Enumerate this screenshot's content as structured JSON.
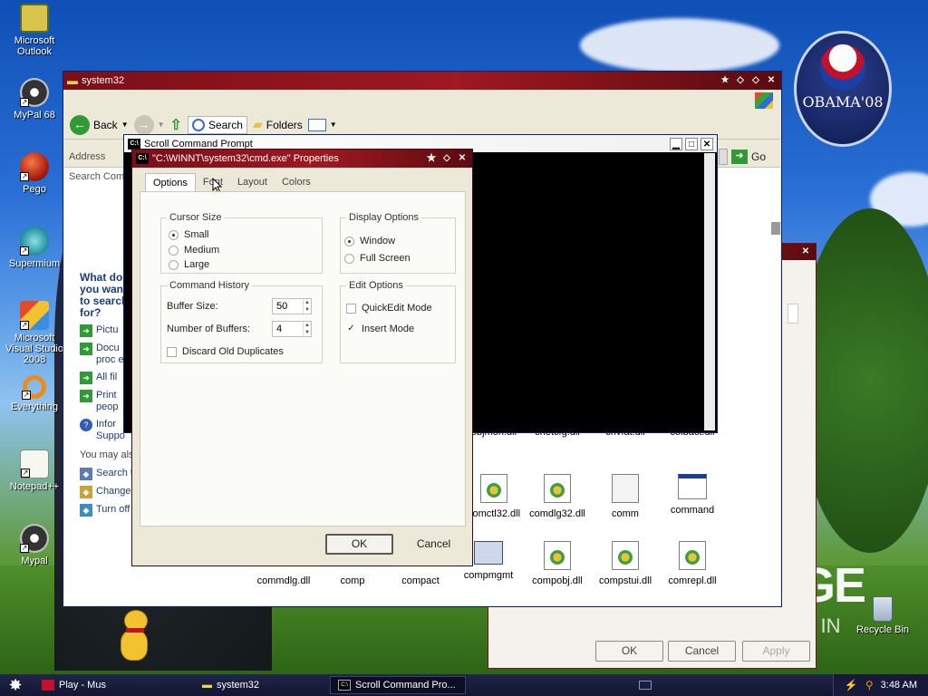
{
  "desktop": {
    "icons": [
      {
        "id": "outlook",
        "label": "Microsoft Outlook",
        "icon": "outlook-icon"
      },
      {
        "id": "mypal68",
        "label": "MyPal 68",
        "icon": "mypal-icon"
      },
      {
        "id": "pego",
        "label": "Pego",
        "icon": "pego-icon"
      },
      {
        "id": "supermium",
        "label": "Supermium",
        "icon": "supermium-icon"
      },
      {
        "id": "vs2008",
        "label": "Microsoft Visual Studio 2008",
        "icon": "visual-studio-icon"
      },
      {
        "id": "everything",
        "label": "Everything",
        "icon": "everything-icon"
      },
      {
        "id": "notepadpp",
        "label": "Notepad++",
        "icon": "notepadpp-icon"
      },
      {
        "id": "mypal",
        "label": "Mypal",
        "icon": "mypal-icon"
      },
      {
        "id": "recycle",
        "label": "Recycle Bin",
        "icon": "recycle-bin-icon"
      }
    ],
    "badge_text": "OBAMA'08",
    "wallpaper_big_text": "GE",
    "wallpaper_sub_text": "VE IN"
  },
  "explorer": {
    "title": "system32",
    "back_label": "Back",
    "search_label": "Search",
    "folders_label": "Folders",
    "address_label": "Address",
    "go_label": "Go",
    "search_companion": "Search Com",
    "task_pane": {
      "heading": "What do you want to search for?",
      "links": [
        "Pictu",
        "Docu proc etc.)",
        "All fil",
        "Print peop",
        "Infor Suppo"
      ],
      "also_label": "You may also",
      "extra": [
        "Search t",
        "Change",
        "Turn off"
      ]
    },
    "files_row1": [
      "objmon.dll",
      "cnetcfg.dll",
      "cnvfat.dll",
      "colbact.dll"
    ],
    "files_row2": [
      "comctl32.dll",
      "comdlg32.dll",
      "comm",
      "command"
    ],
    "files_row3": [
      "commdlg.dll",
      "comp",
      "compact",
      "compmgmt",
      "compobj.dll",
      "compstui.dll",
      "comrepl.dll"
    ]
  },
  "console": {
    "title": "Scroll Command Prompt"
  },
  "properties": {
    "title": "\"C:\\WINNT\\system32\\cmd.exe\" Properties",
    "tabs": [
      "Options",
      "Font",
      "Layout",
      "Colors"
    ],
    "cursor_size": {
      "label": "Cursor Size",
      "options": [
        "Small",
        "Medium",
        "Large"
      ],
      "selected": "Small"
    },
    "display_options": {
      "label": "Display Options",
      "options": [
        "Window",
        "Full Screen"
      ],
      "selected": "Window"
    },
    "command_history": {
      "label": "Command History",
      "buffer_size_label": "Buffer Size:",
      "buffer_size": "50",
      "num_buffers_label": "Number of Buffers:",
      "num_buffers": "4",
      "discard_label": "Discard Old Duplicates"
    },
    "edit_options": {
      "label": "Edit Options",
      "quickedit_label": "QuickEdit Mode",
      "insert_label": "Insert Mode"
    },
    "ok_label": "OK",
    "cancel_label": "Cancel"
  },
  "background_dialog": {
    "ok_label": "OK",
    "cancel_label": "Cancel",
    "apply_label": "Apply"
  },
  "taskbar": {
    "tasks": [
      "Play - Mus",
      "system32",
      "Scroll Command Pro..."
    ],
    "clock": "3:48 AM"
  },
  "colors": {
    "title_red": "#7a0f18",
    "taskbar": "#121630",
    "link_blue": "#1c3b7a",
    "go_green": "#2f9a36"
  }
}
